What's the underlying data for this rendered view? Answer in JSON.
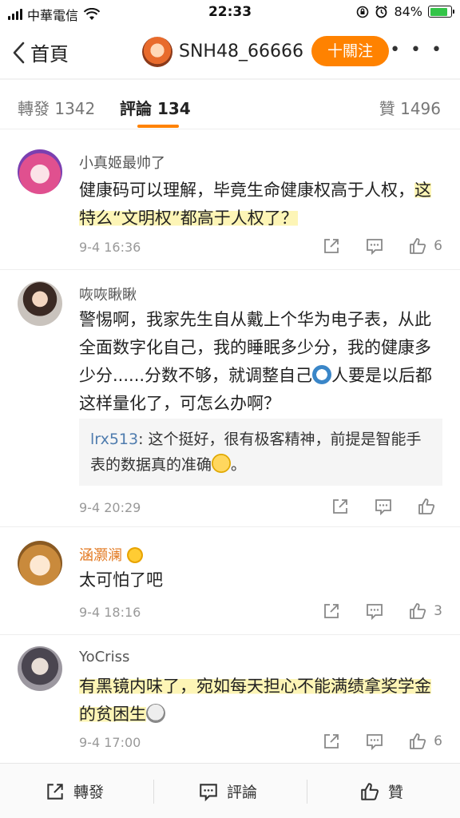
{
  "status_bar": {
    "carrier": "中華電信",
    "time": "22:33",
    "battery": "84%",
    "battery_level": 0.84
  },
  "nav": {
    "back_label": "首頁",
    "username": "SNH48_66666",
    "follow_label": "十關注",
    "more": "• • •"
  },
  "tabs": {
    "repost": "轉發 1342",
    "comments": "評論 134",
    "likes": "贊 1496"
  },
  "comments": [
    {
      "user": "小真姬最帅了",
      "text_plain": "健康码可以理解，毕竟生命健康权高于人权，",
      "text_highlight": "这特么“文明权”都高于人权了？",
      "time": "9-4 16:36",
      "likes": "6"
    },
    {
      "user": "咴咴瞅瞅",
      "text_plain": "警惕啊，我家先生自从戴上个华为电子表，从此全面数字化自己，我的睡眠多少分，我的健康多少分......分数不够，就调整自己",
      "text_after": "人要是以后都这样量化了，可怎么办啊？",
      "reply_user": "lrx513",
      "reply_text": ": 这个挺好，很有极客精神，前提是智能手表的数据真的准确",
      "reply_after": "。",
      "time": "9-4 20:29",
      "likes": ""
    },
    {
      "user": "涵灏澜",
      "text_plain": "太可怕了吧",
      "time": "9-4 18:16",
      "likes": "3"
    },
    {
      "user": "YoCriss",
      "text_highlight": "有黑镜内味了，宛如每天担心不能满绩拿奖学金的贫困生",
      "time": "9-4 17:00",
      "likes": "6"
    }
  ],
  "bottom_bar": {
    "repost": "轉發",
    "comment": "評論",
    "like": "贊"
  },
  "colors": {
    "accent": "#ff8200",
    "highlight": "#fdf5b6",
    "reply_user": "#4f7cae"
  }
}
